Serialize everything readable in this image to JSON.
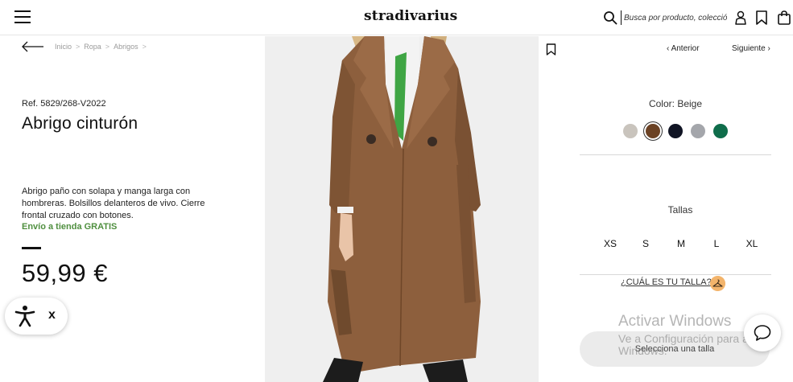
{
  "header": {
    "logo_text": "stradivarius",
    "search_placeholder": "Busca por producto, colección...",
    "icons": [
      "menu-icon",
      "search-icon",
      "user-icon",
      "bookmark-icon",
      "bag-icon"
    ]
  },
  "breadcrumb": {
    "items": [
      "Inicio",
      "Ropa",
      "Abrigos"
    ],
    "separator": ">"
  },
  "product": {
    "reference": "Ref. 5829/268-V2022",
    "title": "Abrigo cinturón",
    "description": "Abrigo paño con solapa y manga larga con hombreras. Bolsillos delanteros de vivo. Cierre frontal cruzado con botones.",
    "shipping": "Envío a tienda GRATIS",
    "price": "59,99 €"
  },
  "navigation": {
    "previous": "Anterior",
    "next": "Siguiente"
  },
  "colors": {
    "label": "Color: Beige",
    "swatches": [
      {
        "name": "beige",
        "hex": "#c9c4bd"
      },
      {
        "name": "brown",
        "hex": "#6b4224",
        "selected": true
      },
      {
        "name": "navy",
        "hex": "#101424"
      },
      {
        "name": "grey",
        "hex": "#a4a6ab"
      },
      {
        "name": "green",
        "hex": "#0f6d4b"
      }
    ]
  },
  "sizes": {
    "label": "Tallas",
    "options": [
      "XS",
      "S",
      "M",
      "L",
      "XL"
    ],
    "guide_link": "¿CUÁL ES TU TALLA?"
  },
  "cta": {
    "add_button": "Selecciona una talla"
  },
  "overlay": {
    "windows_title": "Activar Windows",
    "windows_subtitle": "Ve a Configuración para activar Windows."
  },
  "accessibility": {
    "close_label": "x"
  },
  "colors_theme": {
    "shipping_green": "#4f8f3f",
    "guide_badge": "#f3b46b",
    "button_bg": "#ebebeb"
  }
}
